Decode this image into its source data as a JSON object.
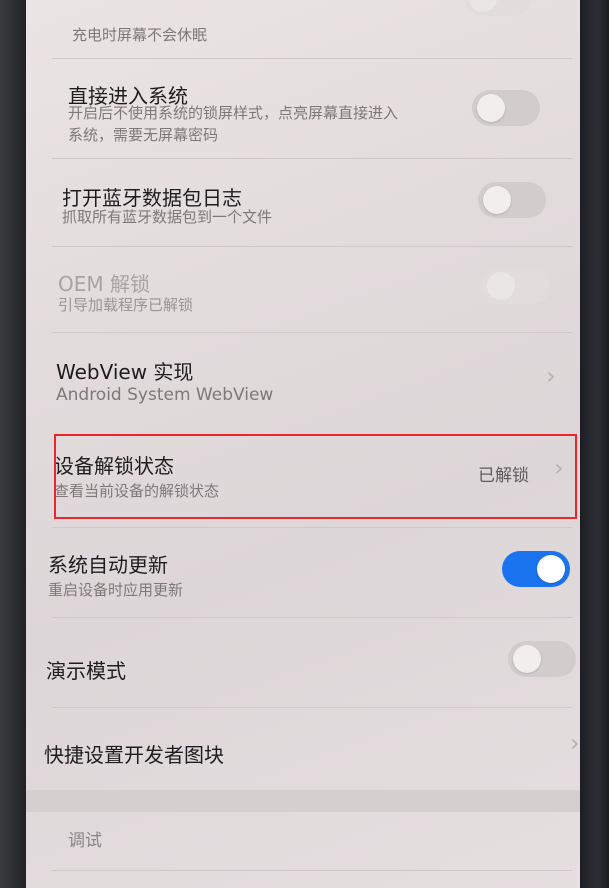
{
  "settings": [
    {
      "key": "stay_awake",
      "title": "",
      "subtitle": "充电时屏幕不会休眠"
    },
    {
      "key": "direct_boot",
      "title": "直接进入系统",
      "subtitle_line1": "开启后不使用系统的锁屏样式，点亮屏幕直接进入",
      "subtitle_line2": "系统，需要无屏幕密码",
      "enabled": false
    },
    {
      "key": "bt_log",
      "title": "打开蓝牙数据包日志",
      "subtitle": "抓取所有蓝牙数据包到一个文件",
      "enabled": false
    },
    {
      "key": "oem_unlock",
      "title": "OEM 解锁",
      "subtitle": "引导加载程序已解锁",
      "enabled": false,
      "disabled": true
    },
    {
      "key": "webview",
      "title": "WebView 实现",
      "subtitle": "Android System WebView"
    },
    {
      "key": "unlock_status",
      "title": "设备解锁状态",
      "subtitle": "查看当前设备的解锁状态",
      "value": "已解锁"
    },
    {
      "key": "auto_update",
      "title": "系统自动更新",
      "subtitle": "重启设备时应用更新",
      "enabled": true
    },
    {
      "key": "demo_mode",
      "title": "演示模式",
      "enabled": false
    },
    {
      "key": "quick_tiles",
      "title": "快捷设置开发者图块"
    }
  ],
  "section": {
    "debug_label": "调试"
  },
  "colors": {
    "accent": "#1a74f0",
    "highlight_border": "#e8262c"
  },
  "icons": {
    "chevron": "chevron-right-icon"
  }
}
